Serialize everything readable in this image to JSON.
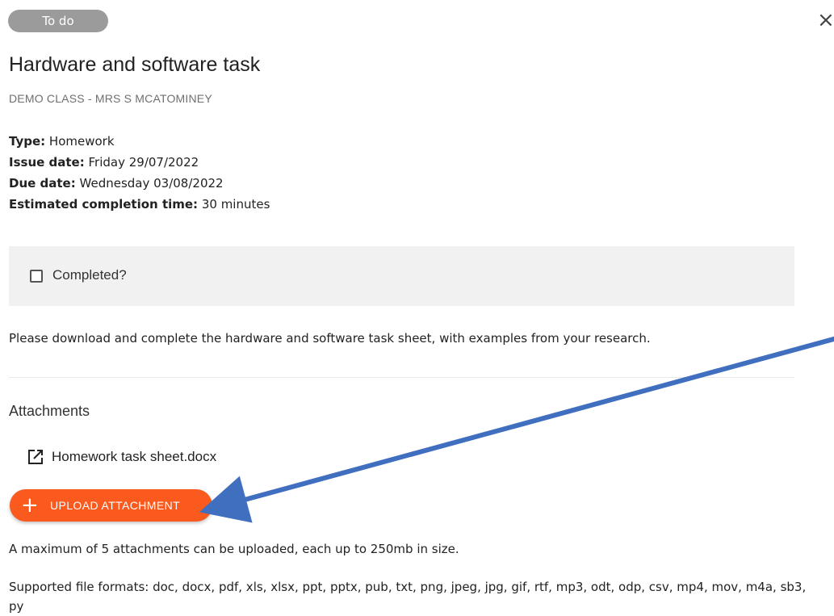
{
  "header": {
    "status": "To do",
    "close_glyph": "×"
  },
  "task": {
    "title": "Hardware and software task",
    "class_name": "DEMO CLASS - MRS S MCATOMINEY",
    "meta": {
      "type_label": "Type:",
      "type_value": "Homework",
      "issue_label": "Issue date:",
      "issue_value": "Friday 29/07/2022",
      "due_label": "Due date:",
      "due_value": "Wednesday 03/08/2022",
      "est_label": "Estimated completion time:",
      "est_value": "30 minutes"
    },
    "completed_label": "Completed?",
    "completed_checked": false,
    "description": "Please download and complete the hardware and software task sheet, with examples from your research."
  },
  "attachments": {
    "heading": "Attachments",
    "items": [
      {
        "name": "Homework task sheet.docx",
        "icon": "external-link-icon"
      }
    ],
    "upload_label": "UPLOAD ATTACHMENT",
    "upload_icon": "+",
    "limit_text": "A maximum of 5 attachments can be uploaded, each up to 250mb in size.",
    "formats_text": "Supported file formats: doc, docx, pdf, xls, xlsx, ppt, pptx, pub, txt, png, jpeg, jpg, gif, rtf, mp3, odt, odp, csv, mp4, mov, m4a, sb3, py"
  },
  "colors": {
    "status_pill": "#9b9b9b",
    "upload_button": "#fa5a1e",
    "completed_bg": "#f1f1f1",
    "annotation_arrow": "#3f6fbe"
  }
}
